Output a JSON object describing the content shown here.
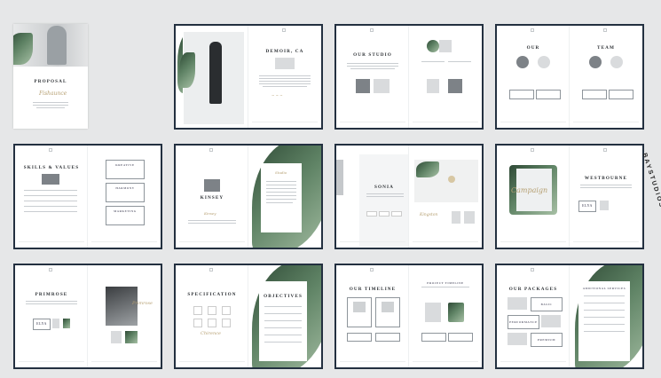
{
  "cover": {
    "title": "PROPOSAL",
    "script": "Fishaunce"
  },
  "spreads": [
    {
      "id": "demoir",
      "title": "DEMOIR, CA"
    },
    {
      "id": "studio",
      "title": "OUR STUDIO"
    },
    {
      "id": "team",
      "title_left": "OUR",
      "title_right": "TEAM"
    },
    {
      "id": "skills",
      "title": "SKILLS & VALUES",
      "boxes": [
        "KREATIVE",
        "HARMONY",
        "MARKETING"
      ]
    },
    {
      "id": "kinsey",
      "title": "KINSEY",
      "script_left": "Kinsey",
      "script_right": "Studio"
    },
    {
      "id": "sonia",
      "title": "SONIA",
      "script": "Kingston"
    },
    {
      "id": "westbourne",
      "title": "WESTBOURNE",
      "script": "Campaign",
      "tag": "ELYA"
    },
    {
      "id": "primrose",
      "title": "PRIMROSE",
      "tag": "ELYA",
      "script": "Primrose"
    },
    {
      "id": "specification",
      "title": "SPECIFICATION",
      "title_right": "OBJECTIVES",
      "script": "Chirence"
    },
    {
      "id": "timeline",
      "title": "OUR TIMELINE",
      "sub": "PROJECT TIMELINE"
    },
    {
      "id": "packages",
      "title": "OUR PACKAGES",
      "box_title": "ADDITIONAL SERVICES",
      "items": [
        "BASIC",
        "PERFORMANCE",
        "PREMIUM"
      ]
    }
  ],
  "brand": "BAYSTUDIOS"
}
